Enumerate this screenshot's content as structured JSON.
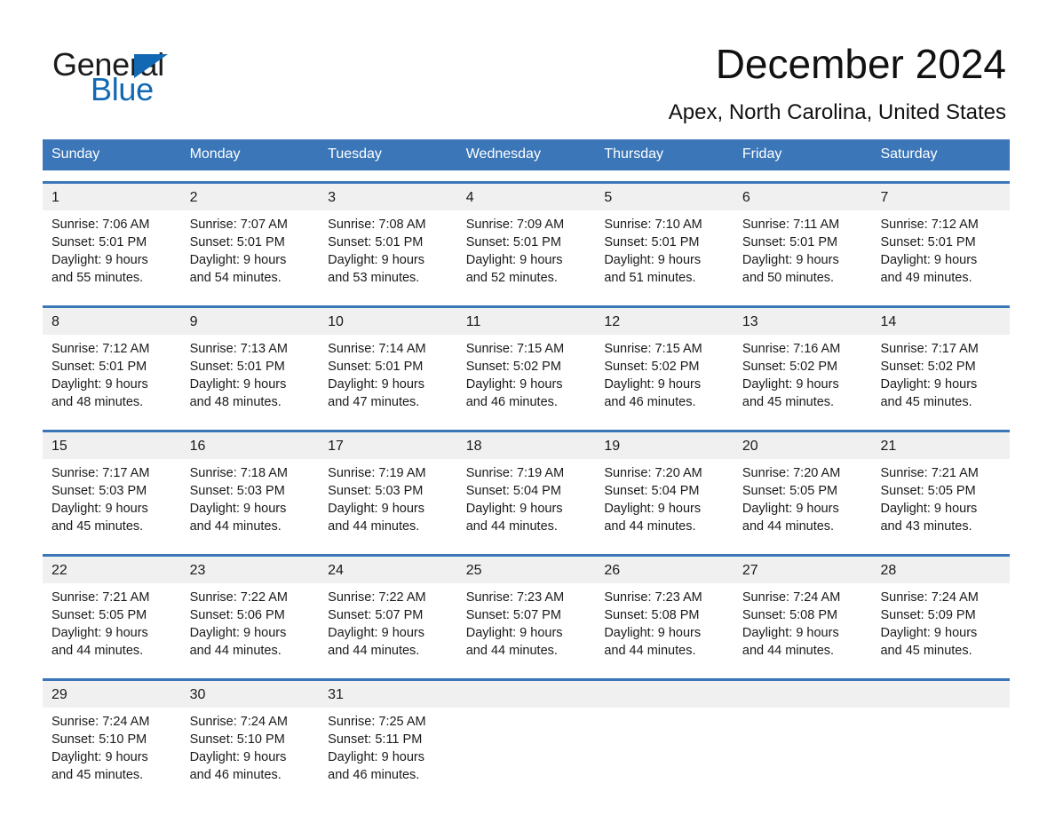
{
  "brand": {
    "name_part1": "General",
    "name_part2": "Blue",
    "accent_color": "#1268b3"
  },
  "header": {
    "title": "December 2024",
    "location": "Apex, North Carolina, United States"
  },
  "theme": {
    "header_blue": "#3a76b8",
    "date_band_gray": "#f0f0f0",
    "text_color": "#1a1a1a"
  },
  "calendar": {
    "weekday_headers": [
      "Sunday",
      "Monday",
      "Tuesday",
      "Wednesday",
      "Thursday",
      "Friday",
      "Saturday"
    ],
    "weeks": [
      {
        "days": [
          {
            "date": "1",
            "sunrise": "Sunrise: 7:06 AM",
            "sunset": "Sunset: 5:01 PM",
            "daylight_line1": "Daylight: 9 hours",
            "daylight_line2": "and 55 minutes."
          },
          {
            "date": "2",
            "sunrise": "Sunrise: 7:07 AM",
            "sunset": "Sunset: 5:01 PM",
            "daylight_line1": "Daylight: 9 hours",
            "daylight_line2": "and 54 minutes."
          },
          {
            "date": "3",
            "sunrise": "Sunrise: 7:08 AM",
            "sunset": "Sunset: 5:01 PM",
            "daylight_line1": "Daylight: 9 hours",
            "daylight_line2": "and 53 minutes."
          },
          {
            "date": "4",
            "sunrise": "Sunrise: 7:09 AM",
            "sunset": "Sunset: 5:01 PM",
            "daylight_line1": "Daylight: 9 hours",
            "daylight_line2": "and 52 minutes."
          },
          {
            "date": "5",
            "sunrise": "Sunrise: 7:10 AM",
            "sunset": "Sunset: 5:01 PM",
            "daylight_line1": "Daylight: 9 hours",
            "daylight_line2": "and 51 minutes."
          },
          {
            "date": "6",
            "sunrise": "Sunrise: 7:11 AM",
            "sunset": "Sunset: 5:01 PM",
            "daylight_line1": "Daylight: 9 hours",
            "daylight_line2": "and 50 minutes."
          },
          {
            "date": "7",
            "sunrise": "Sunrise: 7:12 AM",
            "sunset": "Sunset: 5:01 PM",
            "daylight_line1": "Daylight: 9 hours",
            "daylight_line2": "and 49 minutes."
          }
        ]
      },
      {
        "days": [
          {
            "date": "8",
            "sunrise": "Sunrise: 7:12 AM",
            "sunset": "Sunset: 5:01 PM",
            "daylight_line1": "Daylight: 9 hours",
            "daylight_line2": "and 48 minutes."
          },
          {
            "date": "9",
            "sunrise": "Sunrise: 7:13 AM",
            "sunset": "Sunset: 5:01 PM",
            "daylight_line1": "Daylight: 9 hours",
            "daylight_line2": "and 48 minutes."
          },
          {
            "date": "10",
            "sunrise": "Sunrise: 7:14 AM",
            "sunset": "Sunset: 5:01 PM",
            "daylight_line1": "Daylight: 9 hours",
            "daylight_line2": "and 47 minutes."
          },
          {
            "date": "11",
            "sunrise": "Sunrise: 7:15 AM",
            "sunset": "Sunset: 5:02 PM",
            "daylight_line1": "Daylight: 9 hours",
            "daylight_line2": "and 46 minutes."
          },
          {
            "date": "12",
            "sunrise": "Sunrise: 7:15 AM",
            "sunset": "Sunset: 5:02 PM",
            "daylight_line1": "Daylight: 9 hours",
            "daylight_line2": "and 46 minutes."
          },
          {
            "date": "13",
            "sunrise": "Sunrise: 7:16 AM",
            "sunset": "Sunset: 5:02 PM",
            "daylight_line1": "Daylight: 9 hours",
            "daylight_line2": "and 45 minutes."
          },
          {
            "date": "14",
            "sunrise": "Sunrise: 7:17 AM",
            "sunset": "Sunset: 5:02 PM",
            "daylight_line1": "Daylight: 9 hours",
            "daylight_line2": "and 45 minutes."
          }
        ]
      },
      {
        "days": [
          {
            "date": "15",
            "sunrise": "Sunrise: 7:17 AM",
            "sunset": "Sunset: 5:03 PM",
            "daylight_line1": "Daylight: 9 hours",
            "daylight_line2": "and 45 minutes."
          },
          {
            "date": "16",
            "sunrise": "Sunrise: 7:18 AM",
            "sunset": "Sunset: 5:03 PM",
            "daylight_line1": "Daylight: 9 hours",
            "daylight_line2": "and 44 minutes."
          },
          {
            "date": "17",
            "sunrise": "Sunrise: 7:19 AM",
            "sunset": "Sunset: 5:03 PM",
            "daylight_line1": "Daylight: 9 hours",
            "daylight_line2": "and 44 minutes."
          },
          {
            "date": "18",
            "sunrise": "Sunrise: 7:19 AM",
            "sunset": "Sunset: 5:04 PM",
            "daylight_line1": "Daylight: 9 hours",
            "daylight_line2": "and 44 minutes."
          },
          {
            "date": "19",
            "sunrise": "Sunrise: 7:20 AM",
            "sunset": "Sunset: 5:04 PM",
            "daylight_line1": "Daylight: 9 hours",
            "daylight_line2": "and 44 minutes."
          },
          {
            "date": "20",
            "sunrise": "Sunrise: 7:20 AM",
            "sunset": "Sunset: 5:05 PM",
            "daylight_line1": "Daylight: 9 hours",
            "daylight_line2": "and 44 minutes."
          },
          {
            "date": "21",
            "sunrise": "Sunrise: 7:21 AM",
            "sunset": "Sunset: 5:05 PM",
            "daylight_line1": "Daylight: 9 hours",
            "daylight_line2": "and 43 minutes."
          }
        ]
      },
      {
        "days": [
          {
            "date": "22",
            "sunrise": "Sunrise: 7:21 AM",
            "sunset": "Sunset: 5:05 PM",
            "daylight_line1": "Daylight: 9 hours",
            "daylight_line2": "and 44 minutes."
          },
          {
            "date": "23",
            "sunrise": "Sunrise: 7:22 AM",
            "sunset": "Sunset: 5:06 PM",
            "daylight_line1": "Daylight: 9 hours",
            "daylight_line2": "and 44 minutes."
          },
          {
            "date": "24",
            "sunrise": "Sunrise: 7:22 AM",
            "sunset": "Sunset: 5:07 PM",
            "daylight_line1": "Daylight: 9 hours",
            "daylight_line2": "and 44 minutes."
          },
          {
            "date": "25",
            "sunrise": "Sunrise: 7:23 AM",
            "sunset": "Sunset: 5:07 PM",
            "daylight_line1": "Daylight: 9 hours",
            "daylight_line2": "and 44 minutes."
          },
          {
            "date": "26",
            "sunrise": "Sunrise: 7:23 AM",
            "sunset": "Sunset: 5:08 PM",
            "daylight_line1": "Daylight: 9 hours",
            "daylight_line2": "and 44 minutes."
          },
          {
            "date": "27",
            "sunrise": "Sunrise: 7:24 AM",
            "sunset": "Sunset: 5:08 PM",
            "daylight_line1": "Daylight: 9 hours",
            "daylight_line2": "and 44 minutes."
          },
          {
            "date": "28",
            "sunrise": "Sunrise: 7:24 AM",
            "sunset": "Sunset: 5:09 PM",
            "daylight_line1": "Daylight: 9 hours",
            "daylight_line2": "and 45 minutes."
          }
        ]
      },
      {
        "days": [
          {
            "date": "29",
            "sunrise": "Sunrise: 7:24 AM",
            "sunset": "Sunset: 5:10 PM",
            "daylight_line1": "Daylight: 9 hours",
            "daylight_line2": "and 45 minutes."
          },
          {
            "date": "30",
            "sunrise": "Sunrise: 7:24 AM",
            "sunset": "Sunset: 5:10 PM",
            "daylight_line1": "Daylight: 9 hours",
            "daylight_line2": "and 46 minutes."
          },
          {
            "date": "31",
            "sunrise": "Sunrise: 7:25 AM",
            "sunset": "Sunset: 5:11 PM",
            "daylight_line1": "Daylight: 9 hours",
            "daylight_line2": "and 46 minutes."
          },
          {
            "date": "",
            "sunrise": "",
            "sunset": "",
            "daylight_line1": "",
            "daylight_line2": ""
          },
          {
            "date": "",
            "sunrise": "",
            "sunset": "",
            "daylight_line1": "",
            "daylight_line2": ""
          },
          {
            "date": "",
            "sunrise": "",
            "sunset": "",
            "daylight_line1": "",
            "daylight_line2": ""
          },
          {
            "date": "",
            "sunrise": "",
            "sunset": "",
            "daylight_line1": "",
            "daylight_line2": ""
          }
        ]
      }
    ]
  }
}
